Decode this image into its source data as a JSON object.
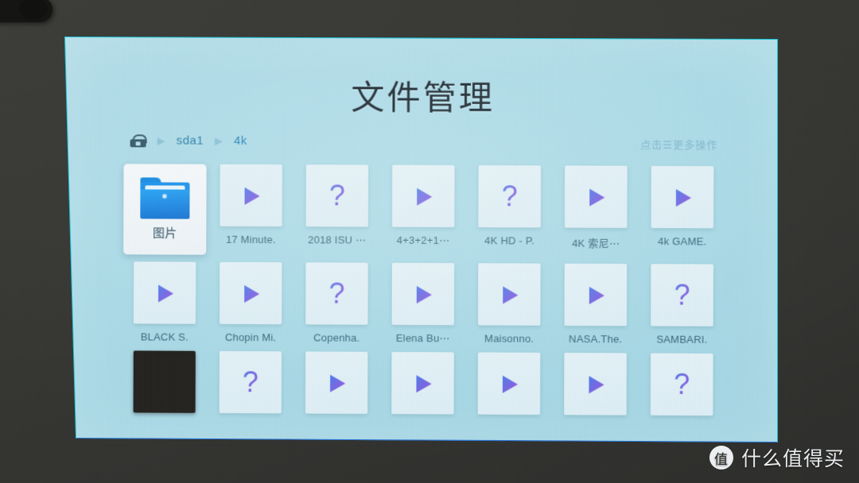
{
  "app": {
    "title": "文件管理"
  },
  "breadcrumb": {
    "disk_icon": "disk-icon",
    "separator": "▶",
    "items": [
      {
        "label": "sda1"
      },
      {
        "label": "4k"
      }
    ]
  },
  "hint": {
    "text": "点击☰更多操作"
  },
  "grid": {
    "rows": [
      {
        "cells": [
          {
            "label": "图片",
            "icon": "folder-icon",
            "selected": true
          },
          {
            "label": "17 Minute.",
            "icon": "play-icon",
            "selected": false
          },
          {
            "label": "2018 ISU ⋯",
            "icon": "question-icon",
            "selected": false
          },
          {
            "label": "4+3+2+1⋯",
            "icon": "play-icon",
            "selected": false
          },
          {
            "label": "4K HD - P.",
            "icon": "question-icon",
            "selected": false
          },
          {
            "label": "4K 索尼⋯",
            "icon": "play-icon",
            "selected": false
          },
          {
            "label": "4k  GAME.",
            "icon": "play-icon",
            "selected": false
          }
        ]
      },
      {
        "cells": [
          {
            "label": "BLACK S.",
            "icon": "play-icon",
            "selected": false
          },
          {
            "label": "Chopin Mi.",
            "icon": "play-icon",
            "selected": false
          },
          {
            "label": "Copenha.",
            "icon": "question-icon",
            "selected": false
          },
          {
            "label": "Elena Bu⋯",
            "icon": "play-icon",
            "selected": false
          },
          {
            "label": "Maisonno.",
            "icon": "play-icon",
            "selected": false
          },
          {
            "label": "NASA.The.",
            "icon": "play-icon",
            "selected": false
          },
          {
            "label": "SAMBARI.",
            "icon": "question-icon",
            "selected": false
          }
        ]
      },
      {
        "cells": [
          {
            "label": "",
            "icon": "dark-thumbnail",
            "selected": false
          },
          {
            "label": "",
            "icon": "question-icon",
            "selected": false
          },
          {
            "label": "",
            "icon": "play-icon",
            "selected": false
          },
          {
            "label": "",
            "icon": "play-icon",
            "selected": false
          },
          {
            "label": "",
            "icon": "play-icon",
            "selected": false
          },
          {
            "label": "",
            "icon": "play-icon",
            "selected": false
          },
          {
            "label": "",
            "icon": "question-icon",
            "selected": false
          }
        ]
      }
    ]
  },
  "watermark": {
    "logo_text": "值",
    "text": "什么值得买"
  },
  "colors": {
    "screen_background": "#aedbe7",
    "screen_rim": "#19c8d8",
    "wall": "#3a3a38",
    "title_text": "#1d2a33",
    "breadcrumb_active": "#2b86b8",
    "label_text": "#40697d",
    "glyph_gradient_start": "#4f7de8",
    "glyph_gradient_end": "#9b55d8",
    "folder_blue": "#1b92e8"
  }
}
